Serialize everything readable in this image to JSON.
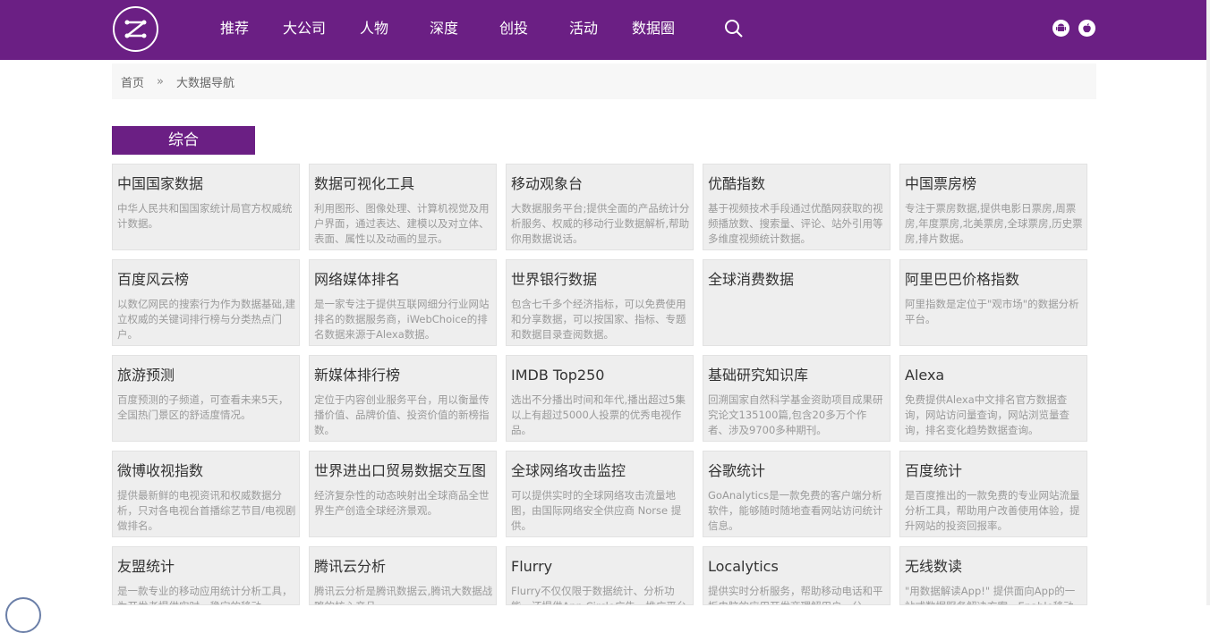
{
  "nav": {
    "items": [
      {
        "label": "推荐"
      },
      {
        "label": "大公司"
      },
      {
        "label": "人物"
      },
      {
        "label": "深度"
      },
      {
        "label": "创投"
      },
      {
        "label": "活动"
      },
      {
        "label": "数据圈"
      }
    ]
  },
  "icons": {
    "logo": "logo-icon",
    "search": "search-icon",
    "android": "android-icon",
    "apple": "apple-icon"
  },
  "colors": {
    "brand": "#6b1f84",
    "card_bg": "#eeeeee",
    "breadcrumb_bg": "#f7f7f7"
  },
  "breadcrumb": {
    "home": "首页",
    "separator": "»",
    "current": "大数据导航"
  },
  "section": {
    "title": "综合"
  },
  "cards": [
    {
      "title": "中国国家数据",
      "desc": "中华人民共和国国家统计局官方权威统计数据。"
    },
    {
      "title": "数据可视化工具",
      "desc": "利用图形、图像处理、计算机视觉及用户界面，通过表达、建模以及对立体、表面、属性以及动画的显示。"
    },
    {
      "title": "移动观象台",
      "desc": "大数据服务平台;提供全面的产品统计分析服务、权威的移动行业数据解析,帮助你用数据说话。"
    },
    {
      "title": "优酷指数",
      "desc": "基于视频技术手段通过优酷网获取的视频播放数、搜索量、评论、站外引用等多维度视频统计数据。"
    },
    {
      "title": "中国票房榜",
      "desc": "专注于票房数据,提供电影日票房,周票房,年度票房,北美票房,全球票房,历史票房,排片数据。"
    },
    {
      "title": "百度风云榜",
      "desc": "以数亿网民的搜索行为作为数据基础,建立权威的关键词排行榜与分类热点门户。"
    },
    {
      "title": "网络媒体排名",
      "desc": "是一家专注于提供互联网细分行业网站排名的数据服务商，iWebChoice的排名数据来源于Alexa数据。"
    },
    {
      "title": "世界银行数据",
      "desc": "包含七千多个经济指标，可以免费使用和分享数据，可以按国家、指标、专题和数据目录查阅数据。"
    },
    {
      "title": "全球消费数据",
      "desc": ""
    },
    {
      "title": "阿里巴巴价格指数",
      "desc": "阿里指数是定位于\"观市场\"的数据分析平台。"
    },
    {
      "title": "旅游预测",
      "desc": "百度预测的子频道，可查看未来5天，全国热门景区的舒适度情况。"
    },
    {
      "title": "新媒体排行榜",
      "desc": "定位于内容创业服务平台，用以衡量传播价值、品牌价值、投资价值的新榜指数。"
    },
    {
      "title": "IMDB Top250",
      "desc": "选出不分播出时间和年代,播出超过5集以上有超过5000人投票的优秀电视作品。"
    },
    {
      "title": "基础研究知识库",
      "desc": "回溯国家自然科学基金资助项目成果研究论文135100篇,包含20多万个作者、涉及9700多种期刊。"
    },
    {
      "title": "Alexa",
      "desc": "免费提供Alexa中文排名官方数据查询，网站访问量查询，网站浏览量查询，排名变化趋势数据查询。"
    },
    {
      "title": "微博收视指数",
      "desc": "提供最新鲜的电视资讯和权威数据分析，只对各电视台首播综艺节目/电视剧做排名。"
    },
    {
      "title": "世界进出口贸易数据交互图",
      "desc": "经济复杂性的动态映射出全球商品全世界生产创造全球经济景观。"
    },
    {
      "title": "全球网络攻击监控",
      "desc": "可以提供实时的全球网络攻击流量地图，由国际网络安全供应商 Norse 提供。"
    },
    {
      "title": "谷歌统计",
      "desc": "GoAnalytics是一款免费的客户端分析软件，能够随时随地查看网站访问统计信息。"
    },
    {
      "title": "百度统计",
      "desc": "是百度推出的一款免费的专业网站流量分析工具，帮助用户改善使用体验，提升网站的投资回报率。"
    },
    {
      "title": "友盟统计",
      "desc": "是一款专业的移动应用统计分析工具，为开发者提供实时、稳定的移动"
    },
    {
      "title": "腾讯云分析",
      "desc": "腾讯云分析是腾讯数据云,腾讯大数据战略的核心产品"
    },
    {
      "title": "Flurry",
      "desc": "Flurry不仅仅限于数据统计、分析功能，还提供App Circle广告、推广平台"
    },
    {
      "title": "Localytics",
      "desc": "提供实时分析服务，帮助移动电话和平板电脑的应用开发商理解用户，分"
    },
    {
      "title": "无线数读",
      "desc": "\"用数据解读App!\" 提供面向App的一站式数据服务解决方案，Enable移动开"
    }
  ]
}
